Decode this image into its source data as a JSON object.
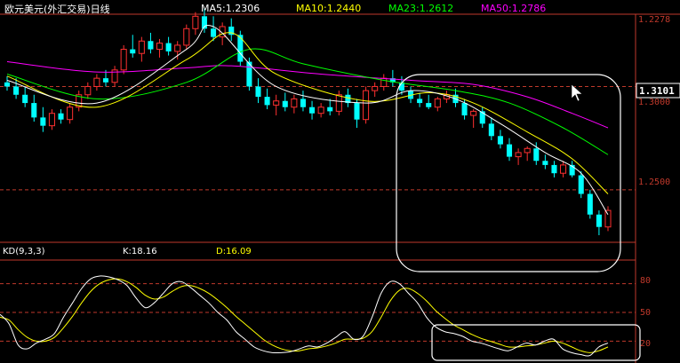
{
  "header": {
    "title": "欧元美元(外汇交易)日线",
    "ma": [
      {
        "label": "MA5:1.2306",
        "color": "#ffffff"
      },
      {
        "label": "MA10:1.2440",
        "color": "#ffff00"
      },
      {
        "label": "MA23:1.2612",
        "color": "#00ff00"
      },
      {
        "label": "MA50:1.2786",
        "color": "#ff00ff"
      }
    ]
  },
  "axis": {
    "top_label": "1.2278",
    "current_price": "1.3101",
    "mid_label": "1.3000",
    "low_label": "1.2500",
    "kd_levels": [
      "80",
      "50",
      "20"
    ]
  },
  "kd_header": {
    "name": "KD(9,3,3)",
    "k": "K:18.16",
    "d": "D:16.09"
  },
  "colors": {
    "up": "#ff3030",
    "down": "#00ffff",
    "ma5": "#ffffff",
    "ma10": "#ffff00",
    "ma23": "#00ff00",
    "ma50": "#ff00ff",
    "grid": "#c0392b",
    "k": "#ffffff",
    "d": "#ffff00",
    "highlight": "#ffffff"
  },
  "chart_data": [
    {
      "type": "candlestick",
      "title": "欧元美元(外汇交易)日线",
      "ylim": [
        1.225,
        1.335
      ],
      "ticks": [
        1.25,
        1.3
      ],
      "candles": [
        [
          1.302,
          1.305,
          1.298,
          1.3
        ],
        [
          1.3,
          1.304,
          1.294,
          1.296
        ],
        [
          1.296,
          1.3,
          1.29,
          1.292
        ],
        [
          1.292,
          1.296,
          1.283,
          1.285
        ],
        [
          1.285,
          1.29,
          1.278,
          1.281
        ],
        [
          1.281,
          1.289,
          1.279,
          1.287
        ],
        [
          1.287,
          1.289,
          1.282,
          1.284
        ],
        [
          1.284,
          1.292,
          1.282,
          1.29
        ],
        [
          1.29,
          1.298,
          1.288,
          1.296
        ],
        [
          1.296,
          1.302,
          1.294,
          1.3
        ],
        [
          1.3,
          1.306,
          1.298,
          1.304
        ],
        [
          1.304,
          1.308,
          1.3,
          1.302
        ],
        [
          1.302,
          1.31,
          1.3,
          1.308
        ],
        [
          1.308,
          1.32,
          1.306,
          1.318
        ],
        [
          1.318,
          1.325,
          1.314,
          1.316
        ],
        [
          1.316,
          1.324,
          1.312,
          1.322
        ],
        [
          1.322,
          1.326,
          1.316,
          1.318
        ],
        [
          1.318,
          1.323,
          1.314,
          1.321
        ],
        [
          1.321,
          1.324,
          1.315,
          1.317
        ],
        [
          1.317,
          1.322,
          1.313,
          1.32
        ],
        [
          1.32,
          1.33,
          1.318,
          1.328
        ],
        [
          1.328,
          1.336,
          1.325,
          1.334
        ],
        [
          1.334,
          1.338,
          1.326,
          1.328
        ],
        [
          1.328,
          1.334,
          1.322,
          1.324
        ],
        [
          1.324,
          1.331,
          1.32,
          1.329
        ],
        [
          1.329,
          1.333,
          1.322,
          1.325
        ],
        [
          1.325,
          1.327,
          1.31,
          1.312
        ],
        [
          1.312,
          1.314,
          1.298,
          1.3
        ],
        [
          1.3,
          1.304,
          1.292,
          1.295
        ],
        [
          1.295,
          1.299,
          1.289,
          1.291
        ],
        [
          1.291,
          1.296,
          1.286,
          1.293
        ],
        [
          1.293,
          1.297,
          1.288,
          1.29
        ],
        [
          1.29,
          1.296,
          1.287,
          1.294
        ],
        [
          1.294,
          1.298,
          1.288,
          1.29
        ],
        [
          1.29,
          1.293,
          1.284,
          1.287
        ],
        [
          1.287,
          1.292,
          1.285,
          1.29
        ],
        [
          1.29,
          1.294,
          1.286,
          1.288
        ],
        [
          1.288,
          1.298,
          1.286,
          1.296
        ],
        [
          1.296,
          1.299,
          1.29,
          1.292
        ],
        [
          1.292,
          1.294,
          1.28,
          1.284
        ],
        [
          1.284,
          1.3,
          1.282,
          1.298
        ],
        [
          1.298,
          1.302,
          1.295,
          1.3
        ],
        [
          1.3,
          1.306,
          1.298,
          1.304
        ],
        [
          1.304,
          1.308,
          1.3,
          1.302
        ],
        [
          1.302,
          1.305,
          1.296,
          1.298
        ],
        [
          1.298,
          1.3,
          1.292,
          1.294
        ],
        [
          1.294,
          1.297,
          1.29,
          1.292
        ],
        [
          1.292,
          1.296,
          1.289,
          1.29
        ],
        [
          1.29,
          1.295,
          1.288,
          1.294
        ],
        [
          1.294,
          1.298,
          1.292,
          1.296
        ],
        [
          1.296,
          1.299,
          1.29,
          1.292
        ],
        [
          1.292,
          1.294,
          1.284,
          1.286
        ],
        [
          1.286,
          1.289,
          1.28,
          1.288
        ],
        [
          1.288,
          1.29,
          1.28,
          1.282
        ],
        [
          1.282,
          1.285,
          1.274,
          1.276
        ],
        [
          1.276,
          1.279,
          1.27,
          1.272
        ],
        [
          1.272,
          1.275,
          1.264,
          1.266
        ],
        [
          1.266,
          1.27,
          1.262,
          1.268
        ],
        [
          1.268,
          1.271,
          1.264,
          1.27
        ],
        [
          1.27,
          1.273,
          1.262,
          1.264
        ],
        [
          1.264,
          1.267,
          1.26,
          1.262
        ],
        [
          1.262,
          1.264,
          1.256,
          1.258
        ],
        [
          1.258,
          1.264,
          1.256,
          1.262
        ],
        [
          1.262,
          1.264,
          1.256,
          1.257
        ],
        [
          1.257,
          1.259,
          1.246,
          1.248
        ],
        [
          1.248,
          1.25,
          1.236,
          1.238
        ],
        [
          1.238,
          1.24,
          1.228,
          1.232
        ],
        [
          1.232,
          1.242,
          1.23,
          1.24
        ]
      ],
      "ma": {
        "ma5": [
          [
            0,
            1.303
          ],
          [
            10,
            1.292
          ],
          [
            20,
            1.318
          ],
          [
            23,
            1.329
          ],
          [
            30,
            1.3
          ],
          [
            40,
            1.292
          ],
          [
            45,
            1.298
          ],
          [
            50,
            1.294
          ],
          [
            55,
            1.282
          ],
          [
            60,
            1.268
          ],
          [
            64,
            1.258
          ],
          [
            67,
            1.238
          ]
        ],
        "ma10": [
          [
            0,
            1.305
          ],
          [
            10,
            1.29
          ],
          [
            20,
            1.313
          ],
          [
            25,
            1.326
          ],
          [
            30,
            1.306
          ],
          [
            40,
            1.293
          ],
          [
            47,
            1.297
          ],
          [
            52,
            1.292
          ],
          [
            58,
            1.278
          ],
          [
            63,
            1.265
          ],
          [
            67,
            1.248
          ]
        ],
        "ma23": [
          [
            0,
            1.306
          ],
          [
            10,
            1.294
          ],
          [
            20,
            1.302
          ],
          [
            27,
            1.318
          ],
          [
            33,
            1.311
          ],
          [
            42,
            1.303
          ],
          [
            50,
            1.298
          ],
          [
            56,
            1.292
          ],
          [
            62,
            1.28
          ],
          [
            67,
            1.267
          ]
        ],
        "ma50": [
          [
            0,
            1.312
          ],
          [
            10,
            1.307
          ],
          [
            20,
            1.309
          ],
          [
            25,
            1.31
          ],
          [
            35,
            1.306
          ],
          [
            45,
            1.303
          ],
          [
            52,
            1.301
          ],
          [
            58,
            1.295
          ],
          [
            63,
            1.287
          ],
          [
            67,
            1.28
          ]
        ]
      }
    },
    {
      "type": "line",
      "title": "KD(9,3,3)",
      "ylim": [
        0,
        100
      ],
      "levels": [
        20,
        50,
        80
      ],
      "series": [
        {
          "name": "K",
          "values": [
            48,
            38,
            16,
            12,
            18,
            22,
            28,
            45,
            60,
            75,
            85,
            88,
            87,
            84,
            78,
            65,
            55,
            60,
            70,
            80,
            82,
            76,
            68,
            60,
            50,
            42,
            30,
            22,
            14,
            10,
            8,
            8,
            9,
            12,
            15,
            14,
            18,
            24,
            30,
            22,
            25,
            45,
            70,
            82,
            80,
            70,
            60,
            45,
            35,
            30,
            28,
            25,
            20,
            18,
            15,
            12,
            10,
            14,
            18,
            16,
            20,
            22,
            12,
            8,
            6,
            5,
            14,
            18
          ]
        },
        {
          "name": "D",
          "values": [
            45,
            42,
            32,
            24,
            20,
            20,
            24,
            34,
            46,
            60,
            72,
            80,
            84,
            85,
            82,
            76,
            68,
            64,
            66,
            72,
            77,
            78,
            75,
            70,
            63,
            55,
            46,
            38,
            30,
            22,
            16,
            12,
            10,
            10,
            12,
            13,
            15,
            18,
            22,
            22,
            23,
            30,
            45,
            62,
            73,
            75,
            70,
            62,
            52,
            44,
            37,
            32,
            27,
            23,
            20,
            17,
            14,
            14,
            15,
            16,
            18,
            20,
            18,
            14,
            10,
            8,
            10,
            14
          ]
        }
      ]
    }
  ]
}
